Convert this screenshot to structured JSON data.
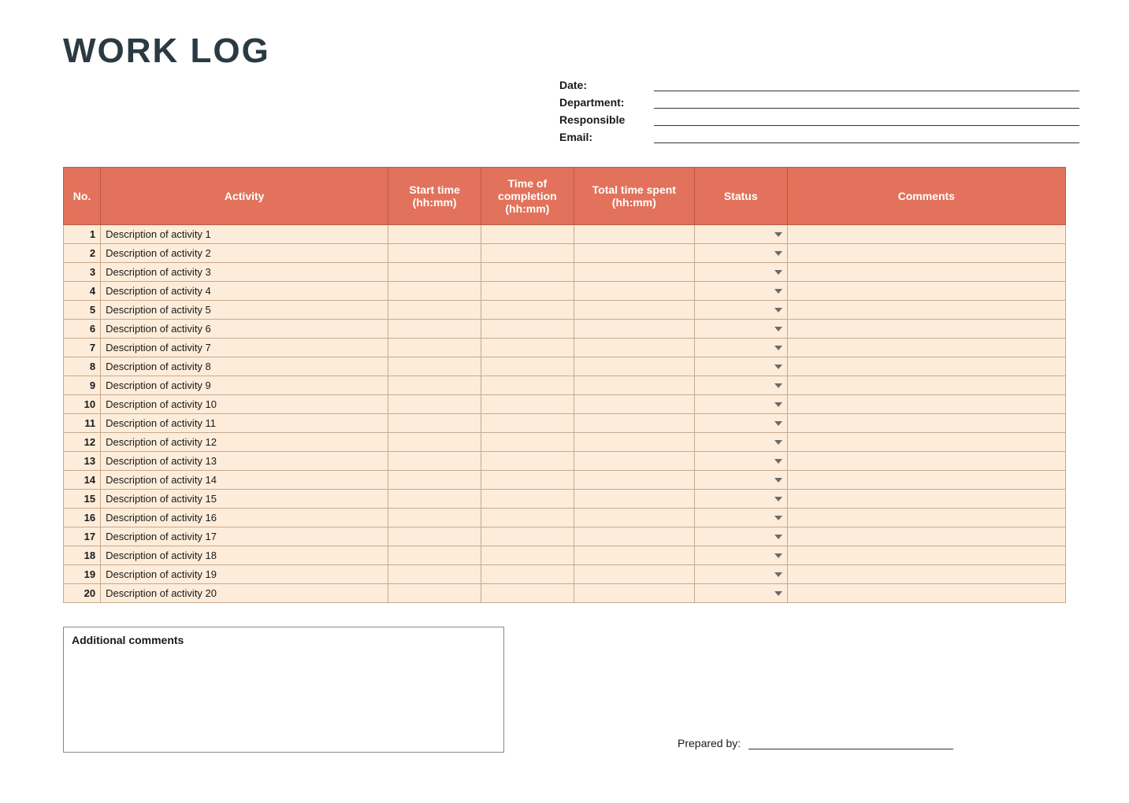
{
  "title": "WORK LOG",
  "meta": {
    "date_label": "Date:",
    "department_label": "Department:",
    "responsible_label": "Responsible",
    "email_label": "Email:",
    "date_value": "",
    "department_value": "",
    "responsible_value": "",
    "email_value": ""
  },
  "headers": {
    "no": "No.",
    "activity": "Activity",
    "start": "Start time (hh:mm)",
    "end": "Time of completion (hh:mm)",
    "total": "Total time spent (hh:mm)",
    "status": "Status",
    "comments": "Comments"
  },
  "rows": [
    {
      "no": "1",
      "activity": "Description of activity 1",
      "start": "",
      "end": "",
      "total": "",
      "status": "",
      "comments": ""
    },
    {
      "no": "2",
      "activity": "Description of activity 2",
      "start": "",
      "end": "",
      "total": "",
      "status": "",
      "comments": ""
    },
    {
      "no": "3",
      "activity": "Description of activity 3",
      "start": "",
      "end": "",
      "total": "",
      "status": "",
      "comments": ""
    },
    {
      "no": "4",
      "activity": "Description of activity 4",
      "start": "",
      "end": "",
      "total": "",
      "status": "",
      "comments": ""
    },
    {
      "no": "5",
      "activity": "Description of activity 5",
      "start": "",
      "end": "",
      "total": "",
      "status": "",
      "comments": ""
    },
    {
      "no": "6",
      "activity": "Description of activity 6",
      "start": "",
      "end": "",
      "total": "",
      "status": "",
      "comments": ""
    },
    {
      "no": "7",
      "activity": "Description of activity 7",
      "start": "",
      "end": "",
      "total": "",
      "status": "",
      "comments": ""
    },
    {
      "no": "8",
      "activity": "Description of activity 8",
      "start": "",
      "end": "",
      "total": "",
      "status": "",
      "comments": ""
    },
    {
      "no": "9",
      "activity": "Description of activity 9",
      "start": "",
      "end": "",
      "total": "",
      "status": "",
      "comments": ""
    },
    {
      "no": "10",
      "activity": "Description of activity 10",
      "start": "",
      "end": "",
      "total": "",
      "status": "",
      "comments": ""
    },
    {
      "no": "11",
      "activity": "Description of activity 11",
      "start": "",
      "end": "",
      "total": "",
      "status": "",
      "comments": ""
    },
    {
      "no": "12",
      "activity": "Description of activity 12",
      "start": "",
      "end": "",
      "total": "",
      "status": "",
      "comments": ""
    },
    {
      "no": "13",
      "activity": "Description of activity 13",
      "start": "",
      "end": "",
      "total": "",
      "status": "",
      "comments": ""
    },
    {
      "no": "14",
      "activity": "Description of activity 14",
      "start": "",
      "end": "",
      "total": "",
      "status": "",
      "comments": ""
    },
    {
      "no": "15",
      "activity": "Description of activity 15",
      "start": "",
      "end": "",
      "total": "",
      "status": "",
      "comments": ""
    },
    {
      "no": "16",
      "activity": "Description of activity 16",
      "start": "",
      "end": "",
      "total": "",
      "status": "",
      "comments": ""
    },
    {
      "no": "17",
      "activity": "Description of activity 17",
      "start": "",
      "end": "",
      "total": "",
      "status": "",
      "comments": ""
    },
    {
      "no": "18",
      "activity": "Description of activity 18",
      "start": "",
      "end": "",
      "total": "",
      "status": "",
      "comments": ""
    },
    {
      "no": "19",
      "activity": "Description of activity 19",
      "start": "",
      "end": "",
      "total": "",
      "status": "",
      "comments": ""
    },
    {
      "no": "20",
      "activity": "Description of activity 20",
      "start": "",
      "end": "",
      "total": "",
      "status": "",
      "comments": ""
    }
  ],
  "additional_label": "Additional comments",
  "additional_value": "",
  "prepared_label": "Prepared by:",
  "prepared_value": ""
}
